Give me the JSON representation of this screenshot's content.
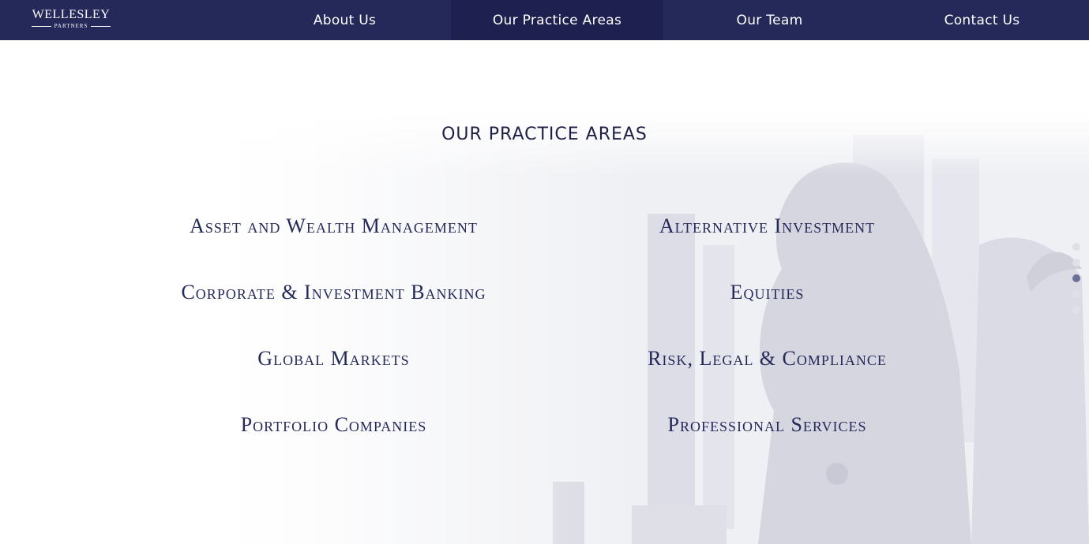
{
  "brand": {
    "name": "WELLESLEY",
    "sub": "PARTNERS"
  },
  "nav": {
    "items": [
      {
        "label": "About Us"
      },
      {
        "label": "Our Practice Areas"
      },
      {
        "label": "Our Team"
      },
      {
        "label": "Contact Us"
      }
    ],
    "active_index": 1
  },
  "section": {
    "title": "OUR PRACTICE AREAS"
  },
  "areas": [
    "Asset and Wealth Management",
    "Alternative Investment",
    "Corporate & Investment Banking",
    "Equities",
    "Global Markets",
    "Risk, Legal & Compliance",
    "Portfolio Companies",
    "Professional Services"
  ],
  "pager": {
    "count": 5,
    "active_index": 2
  },
  "colors": {
    "navbar": "#25295a",
    "text_dark": "#1d1f46",
    "accent": "#25295a"
  }
}
